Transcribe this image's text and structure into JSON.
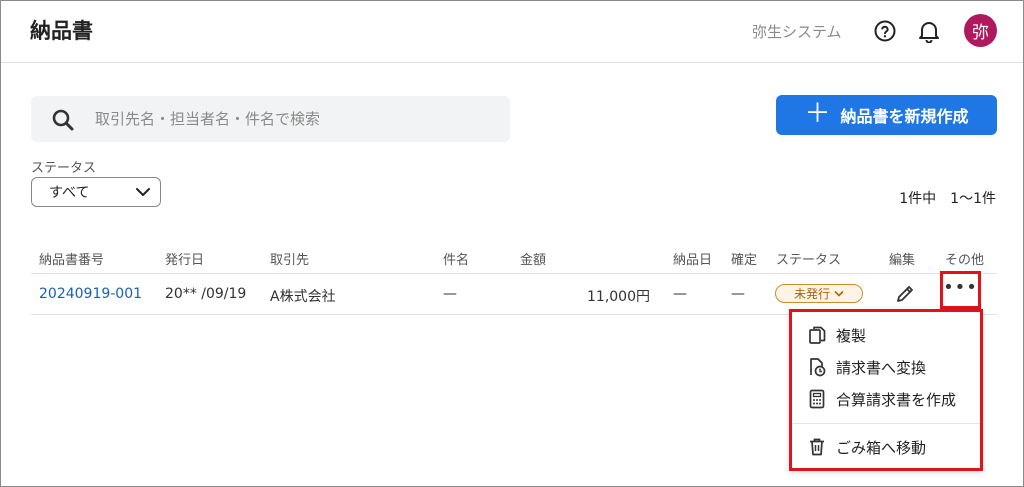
{
  "header": {
    "title": "納品書",
    "org_name": "弥生システム",
    "avatar_text": "弥"
  },
  "search": {
    "placeholder": "取引先名・担当者名・件名で検索",
    "value": ""
  },
  "new_button": {
    "label": "納品書を新規作成"
  },
  "filter": {
    "label": "ステータス",
    "selected": "すべて"
  },
  "result_count": "1件中　1〜1件",
  "table": {
    "columns": [
      "納品書番号",
      "発行日",
      "取引先",
      "件名",
      "金額",
      "納品日",
      "確定",
      "ステータス",
      "編集",
      "その他"
    ],
    "rows": [
      {
        "number": "20240919-001",
        "issue_date": "20** /09/19",
        "client": "A株式会社",
        "subject": "—",
        "amount": "11,000円",
        "delivery_date": "—",
        "confirmed": "—",
        "status": "未発行"
      }
    ]
  },
  "context_menu": {
    "items": [
      {
        "label": "複製",
        "icon": "copy-icon"
      },
      {
        "label": "請求書へ変換",
        "icon": "convert-invoice-icon"
      },
      {
        "label": "合算請求書を作成",
        "icon": "calculator-icon"
      },
      {
        "label": "ごみ箱へ移動",
        "icon": "trash-icon"
      }
    ]
  },
  "colors": {
    "primary": "#1f76e5",
    "avatar": "#b0195e",
    "highlight": "#e0121b",
    "status_badge": "#d28a2e",
    "link": "#1a5fb4"
  }
}
